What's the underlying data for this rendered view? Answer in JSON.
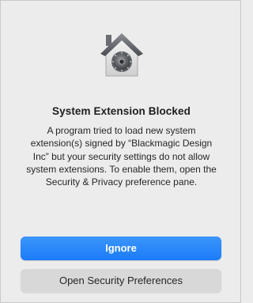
{
  "dialog": {
    "icon": "security-house-lock-icon",
    "title": "System Extension Blocked",
    "message": "A program tried to load new system extension(s) signed by “Blackmagic Design Inc” but your security settings do not allow system extensions. To enable them, open the Security & Privacy preference pane.",
    "buttons": {
      "primary_label": "Ignore",
      "secondary_label": "Open Security Preferences"
    }
  },
  "colors": {
    "primary_button": "#1c7cf7",
    "secondary_button": "#d8d8d8",
    "background": "#ececec"
  }
}
